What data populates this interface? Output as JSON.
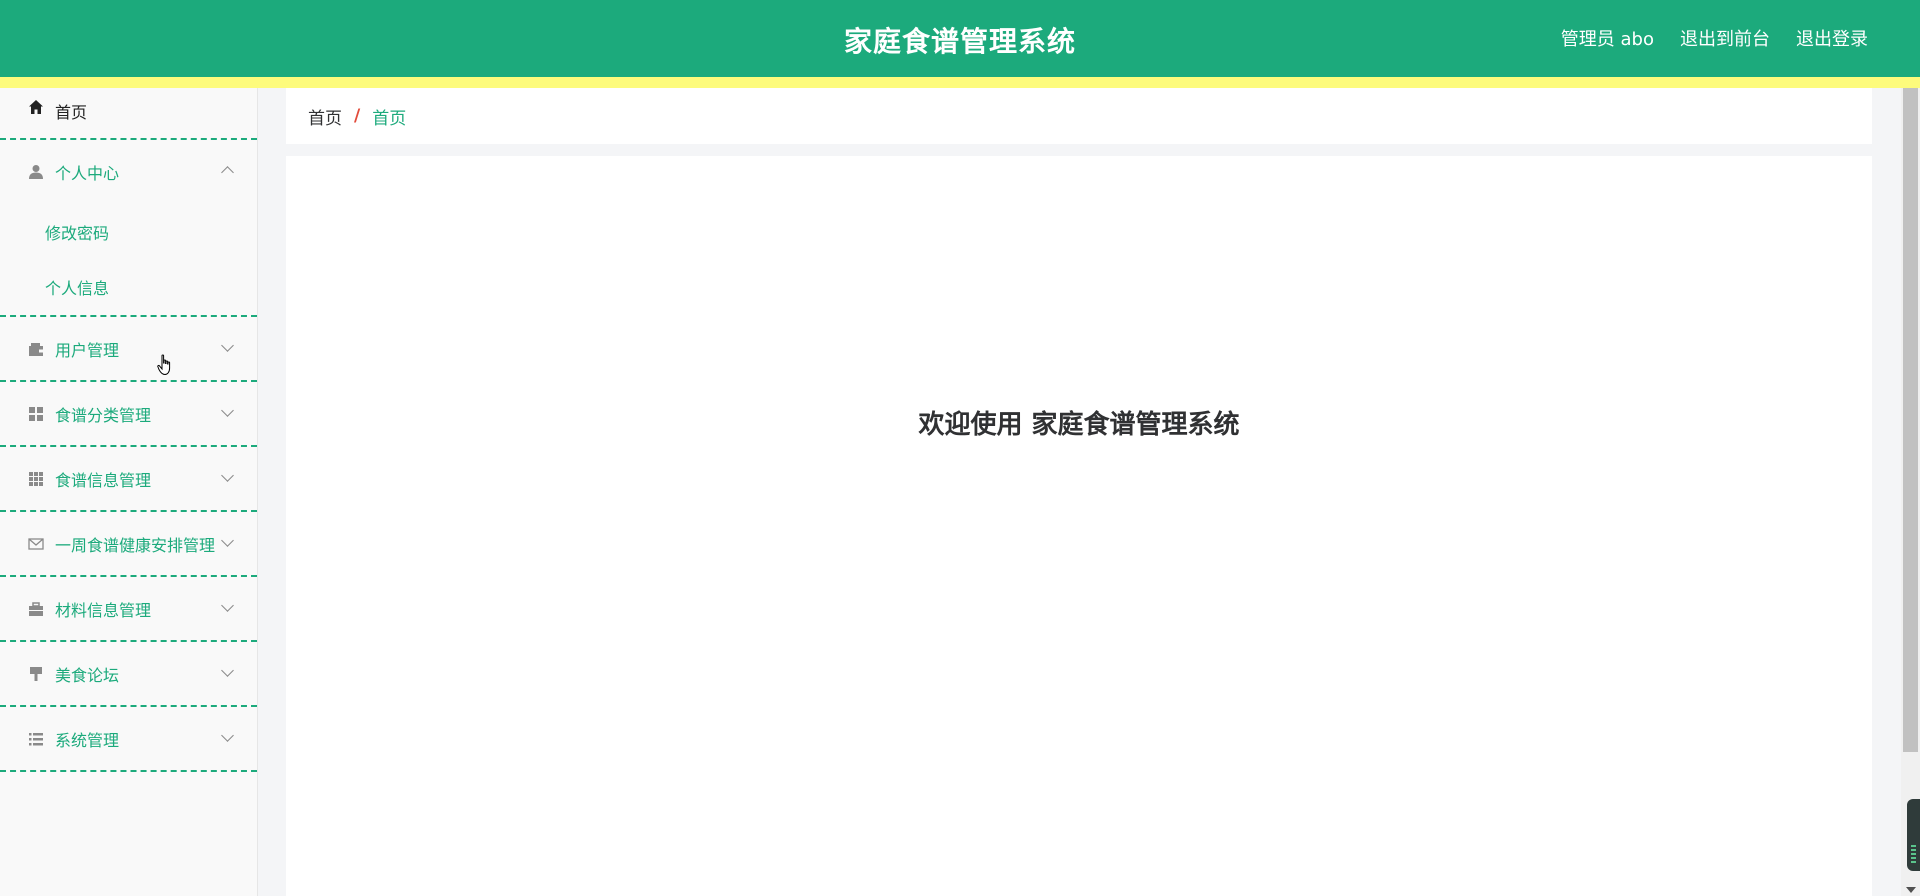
{
  "header": {
    "title": "家庭食谱管理系统",
    "user": "管理员 abo",
    "to_front": "退出到前台",
    "logout": "退出登录"
  },
  "sidebar": {
    "home": "首页",
    "personal_center": {
      "label": "个人中心",
      "children": [
        "修改密码",
        "个人信息"
      ]
    },
    "items": [
      {
        "label": "用户管理",
        "icon": "wallet-icon"
      },
      {
        "label": "食谱分类管理",
        "icon": "grid-icon"
      },
      {
        "label": "食谱信息管理",
        "icon": "apps-icon"
      },
      {
        "label": "一周食谱健康安排管理",
        "icon": "mail-icon"
      },
      {
        "label": "材料信息管理",
        "icon": "briefcase-icon"
      },
      {
        "label": "美食论坛",
        "icon": "brush-icon"
      },
      {
        "label": "系统管理",
        "icon": "list-icon"
      }
    ]
  },
  "breadcrumb": {
    "first": "首页",
    "separator": "/",
    "current": "首页"
  },
  "content": {
    "welcome": "欢迎使用 家庭食谱管理系统"
  },
  "colors": {
    "primary": "#1caa7c",
    "accent_bar": "#fdfb7c",
    "breadcrumb_separator": "#e24b3b"
  }
}
